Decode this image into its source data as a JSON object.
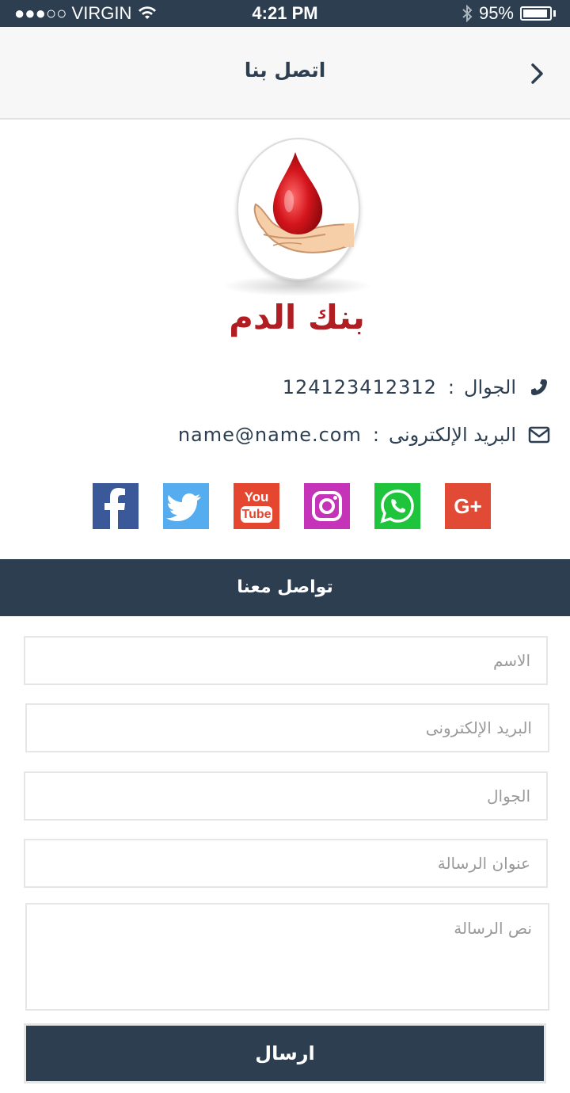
{
  "status_bar": {
    "carrier": "●●●○○ VIRGIN",
    "time": "4:21 PM",
    "battery": "95%"
  },
  "nav": {
    "title": "اتصل بنا",
    "back_icon": "chevron-right-icon"
  },
  "logo": {
    "title": "بنك الدم",
    "colors": {
      "drop": "#d4151c",
      "title": "#b01e24",
      "hand": "#f6cfa8"
    }
  },
  "contact": {
    "phone_label": "الجوال",
    "phone_value": "124123412312",
    "email_label": "البريد الإلكترونى",
    "email_value": "name@name.com",
    "separator": ":"
  },
  "social": [
    {
      "name": "facebook",
      "color": "#3b5998"
    },
    {
      "name": "twitter",
      "color": "#55acee"
    },
    {
      "name": "youtube",
      "color": "#e5462f",
      "label_top": "You",
      "label_bottom": "Tube"
    },
    {
      "name": "instagram",
      "color": "#c534b8"
    },
    {
      "name": "whatsapp",
      "color": "#1dc43c"
    },
    {
      "name": "google-plus",
      "color": "#e14b35",
      "label": "G+"
    }
  ],
  "form": {
    "section_title": "تواصل معنا",
    "name_placeholder": "الاسم",
    "email_placeholder": "البريد الإلكترونى",
    "phone_placeholder": "الجوال",
    "subject_placeholder": "عنوان الرسالة",
    "message_placeholder": "نص الرسالة",
    "submit_label": "ارسال"
  },
  "colors": {
    "primary": "#2c3e50",
    "accent": "#b01e24"
  }
}
